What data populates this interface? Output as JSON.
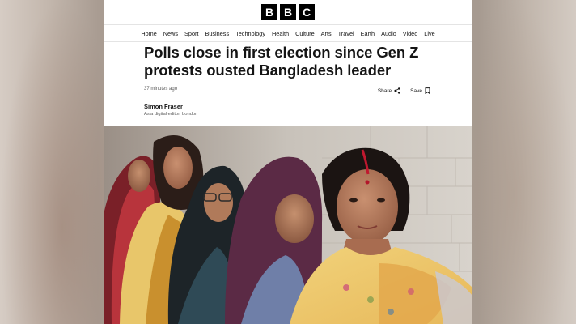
{
  "logo": {
    "letters": [
      "B",
      "B",
      "C"
    ]
  },
  "nav": {
    "items": [
      "Home",
      "News",
      "Sport",
      "Business",
      "Technology",
      "Health",
      "Culture",
      "Arts",
      "Travel",
      "Earth",
      "Audio",
      "Video",
      "Live"
    ]
  },
  "article": {
    "headline": "Polls close in first election since Gen Z protests ousted Bangladesh leader",
    "timestamp": "37 minutes ago",
    "share_label": "Share",
    "save_label": "Save",
    "author": "Simon Fraser",
    "author_role": "Asia digital editor, London"
  },
  "icons": {
    "share": "share-icon",
    "save": "bookmark-icon"
  },
  "colors": {
    "logo_bg": "#000000",
    "logo_text": "#ffffff",
    "text": "#141414",
    "muted": "#5a5a5a"
  }
}
